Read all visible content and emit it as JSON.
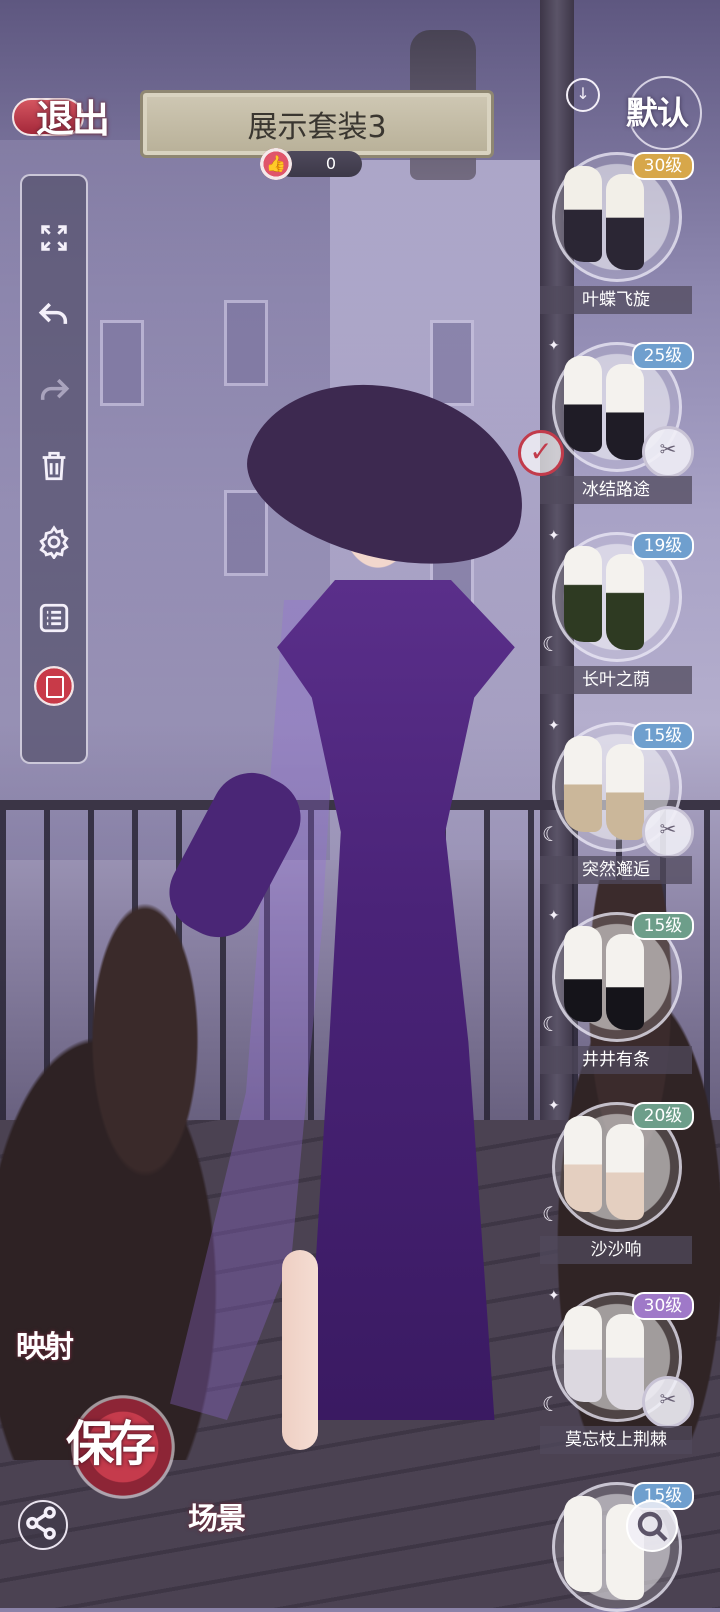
{
  "header": {
    "exit_label": "退出",
    "outfit_title": "展示套装3",
    "like_count": "0"
  },
  "toolbar": {
    "items": [
      "fullscreen-icon",
      "undo-icon",
      "redo-icon",
      "trash-icon",
      "gear-icon",
      "list-icon",
      "record-icon"
    ]
  },
  "right_panel": {
    "default_label": "默认",
    "items": [
      {
        "name": "叶蝶飞旋",
        "level": "30级",
        "level_color": "#d7a74a"
      },
      {
        "name": "冰结路途",
        "level": "25级",
        "level_color": "#6f9fce"
      },
      {
        "name": "长叶之荫",
        "level": "19级",
        "level_color": "#6f9fce"
      },
      {
        "name": "突然邂逅",
        "level": "15级",
        "level_color": "#6f9fce"
      },
      {
        "name": "井井有条",
        "level": "15级",
        "level_color": "#6d9e8a"
      },
      {
        "name": "沙沙响",
        "level": "20级",
        "level_color": "#6d9e8a"
      },
      {
        "name": "莫忘枝上荆棘",
        "level": "30级",
        "level_color": "#9f79c8"
      },
      {
        "name": "",
        "level": "15级",
        "level_color": "#6f9fce"
      }
    ]
  },
  "bottom": {
    "map_label": "映射",
    "save_label": "保存",
    "scene_label": "场景"
  }
}
